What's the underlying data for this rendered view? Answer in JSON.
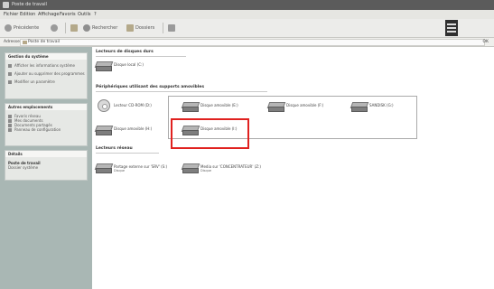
{
  "window": {
    "title": "Poste de travail",
    "menu": [
      "Fichier",
      "Edition",
      "Affichage",
      "Favoris",
      "Outils",
      "?"
    ],
    "toolbar": {
      "back": "Précédente",
      "search": "Rechercher",
      "folders": "Dossiers"
    },
    "address": {
      "label": "Adresse",
      "value": "Poste de travail",
      "go": "OK"
    }
  },
  "sidebar": {
    "panels": [
      {
        "header": "Gestion du système",
        "items": [
          "Afficher les informations système",
          "Ajouter ou supprimer des programmes",
          "Modifier un paramètre"
        ]
      },
      {
        "header": "Autres emplacements",
        "items": [
          "Favoris réseau",
          "Mes documents",
          "Documents partagés",
          "Panneau de configuration"
        ]
      },
      {
        "header": "Détails",
        "text": [
          "Poste de travail",
          "Dossier système"
        ]
      }
    ]
  },
  "content": {
    "sections": {
      "hard_drives": "Lecteurs de disques durs",
      "removable": "Périphériques utilisant des supports amovibles",
      "network": "Lecteurs réseau"
    },
    "hard_drives": [
      {
        "label": "Disque local (C:)"
      }
    ],
    "removable": [
      {
        "label": "Lecteur CD-ROM (D:)",
        "icon": "cdrom-icon"
      },
      {
        "label": "Disque amovible (E:)",
        "icon": "drive-icon"
      },
      {
        "label": "Disque amovible (F:)",
        "icon": "drive-icon"
      },
      {
        "label": "SANDISK (G:)",
        "icon": "drive-icon"
      },
      {
        "label": "Disque amovible (H:)",
        "icon": "drive-icon"
      },
      {
        "label": "Disque amovible (I:)",
        "icon": "drive-icon",
        "highlighted": true
      }
    ],
    "network": [
      {
        "label": "Partage externe sur 'SRV' (S:)",
        "sub": "Disque"
      },
      {
        "label": "Media sur 'CONCENTRATEUR' (Z:)",
        "sub": "Disque"
      }
    ]
  },
  "colors": {
    "highlight": "#e0211f",
    "sidebar_bg": "#a9b7b4"
  }
}
